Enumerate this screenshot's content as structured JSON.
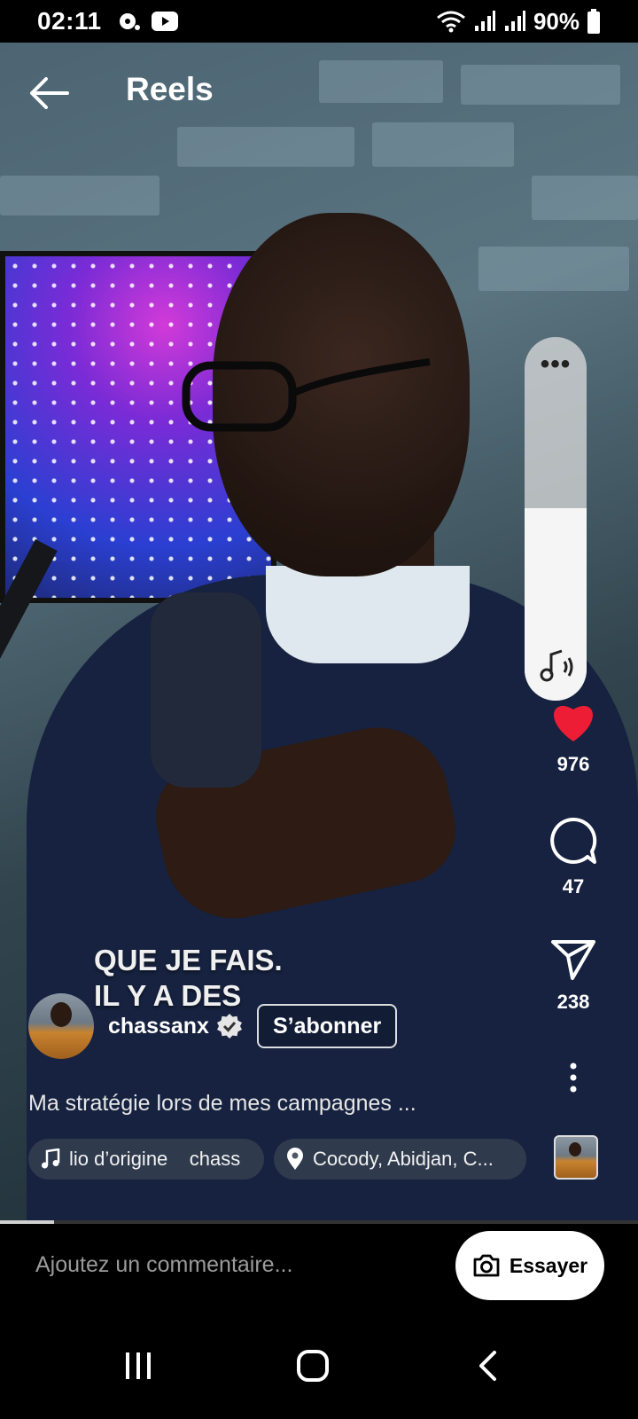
{
  "status_bar": {
    "time": "02:11",
    "battery": "90%",
    "icons": [
      "media-icon",
      "youtube-icon",
      "wifi-icon",
      "signal-icon",
      "signal-icon",
      "battery-icon"
    ]
  },
  "header": {
    "title": "Reels",
    "back_icon": "arrow-left-icon"
  },
  "video": {
    "caption_line1": "QUE JE FAIS.",
    "caption_line2": "IL Y A DES",
    "progress": 0.085
  },
  "volume": {
    "level": 0.53,
    "more_label": "•••"
  },
  "actions": {
    "likes": "976",
    "comments": "47",
    "shares": "238"
  },
  "author": {
    "username": "chassanx",
    "verified": true,
    "follow_label": "S’abonner"
  },
  "description": "Ma stratégie lors de mes campagnes ...",
  "audio_chip": {
    "text": "lio d’origine    chass"
  },
  "location_chip": {
    "text": "Cocody, Abidjan, C..."
  },
  "comment_bar": {
    "placeholder": "Ajoutez un commentaire...",
    "try_label": "Essayer"
  },
  "colors": {
    "like": "#ee1d36",
    "background": "#000000"
  }
}
